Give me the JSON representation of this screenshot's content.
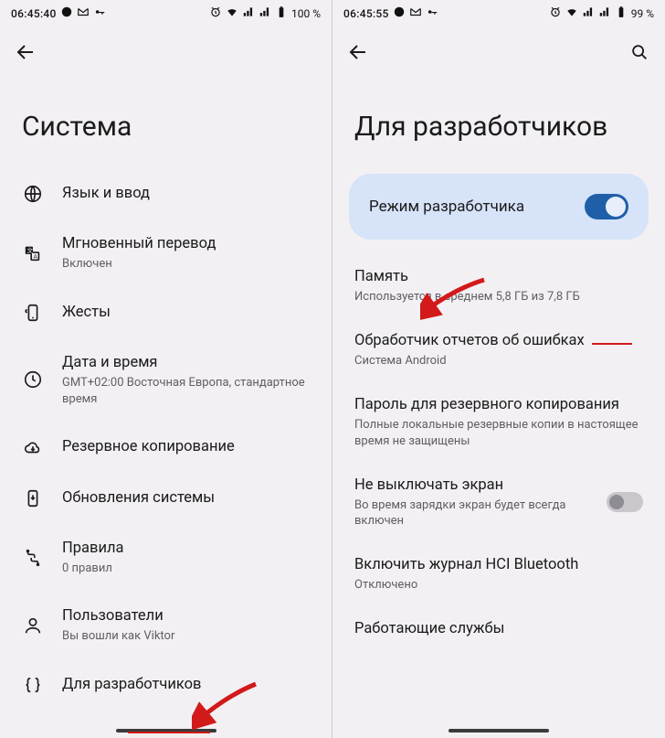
{
  "left": {
    "status": {
      "time": "06:45:40",
      "battery": "100 %"
    },
    "title": "Система",
    "items": [
      {
        "icon": "globe-icon",
        "title": "Язык и ввод",
        "sub": ""
      },
      {
        "icon": "translate-icon",
        "title": "Мгновенный перевод",
        "sub": "Включен"
      },
      {
        "icon": "gesture-icon",
        "title": "Жесты",
        "sub": ""
      },
      {
        "icon": "clock-icon",
        "title": "Дата и время",
        "sub": "GMT+02:00 Восточная Европа, стандартное время"
      },
      {
        "icon": "cloud-icon",
        "title": "Резервное копирование",
        "sub": ""
      },
      {
        "icon": "update-icon",
        "title": "Обновления системы",
        "sub": ""
      },
      {
        "icon": "rules-icon",
        "title": "Правила",
        "sub": "0 правил"
      },
      {
        "icon": "users-icon",
        "title": "Пользователи",
        "sub": "Вы вошли как Viktor"
      },
      {
        "icon": "braces-icon",
        "title": "Для разработчиков",
        "sub": ""
      }
    ]
  },
  "right": {
    "status": {
      "time": "06:45:55",
      "battery": "99 %"
    },
    "title": "Для разработчиков",
    "dev_mode_label": "Режим разработчика",
    "items": [
      {
        "title": "Память",
        "sub": "Используется в среднем 5,8 ГБ из 7,8 ГБ"
      },
      {
        "title": "Обработчик отчетов об ошибках",
        "sub": "Система Android"
      },
      {
        "title": "Пароль для резервного копирования",
        "sub": "Полные локальные резервные копии в настоящее время не защищены"
      },
      {
        "title": "Не выключать экран",
        "sub": "Во время зарядки экран будет всегда включен",
        "switch": true
      },
      {
        "title": "Включить журнал HCI Bluetooth",
        "sub": "Отключено"
      },
      {
        "title": "Работающие службы",
        "sub": ""
      }
    ]
  }
}
